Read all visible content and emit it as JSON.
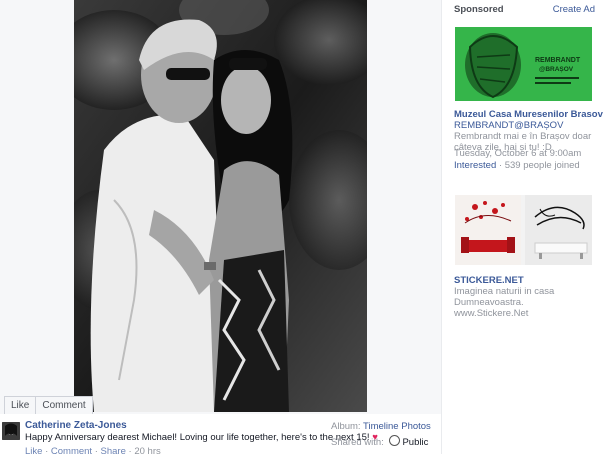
{
  "photo_actions": {
    "like": "Like",
    "comment": "Comment"
  },
  "post": {
    "author": "Catherine Zeta-Jones",
    "caption": "Happy Anniversary dearest Michael! Loving our life together, here's to the next 15!",
    "heart": "♥",
    "like": "Like",
    "comment": "Comment",
    "share": "Share",
    "time": "20 hrs",
    "sep": "·"
  },
  "album": {
    "label": "Album:",
    "name": "Timeline Photos"
  },
  "shared": {
    "label": "Shared with:",
    "audience": "Public"
  },
  "sidebar": {
    "sponsored": "Sponsored",
    "create_ad": "Create Ad",
    "ad1": {
      "image_text_1": "REMBRANDT",
      "image_text_2": "@BRAȘOV",
      "title": "Muzeul Casa Muresenilor Brasov",
      "subtitle": "REMBRANDT@BRAȘOV",
      "body": "Rembrandt mai e în Brașov doar câteva zile, hai și tu! :D",
      "date": "Tuesday, October 6 at 9:00am",
      "cta": "Interested",
      "joined": "539 people joined"
    },
    "ad2": {
      "title": "STICKERE.NET",
      "body": "Imaginea naturii in casa Dumneavoastra. www.Stickere.Net"
    }
  },
  "colors": {
    "link": "#3b5998",
    "ad_green": "#35b54a",
    "muted": "#90949c"
  }
}
